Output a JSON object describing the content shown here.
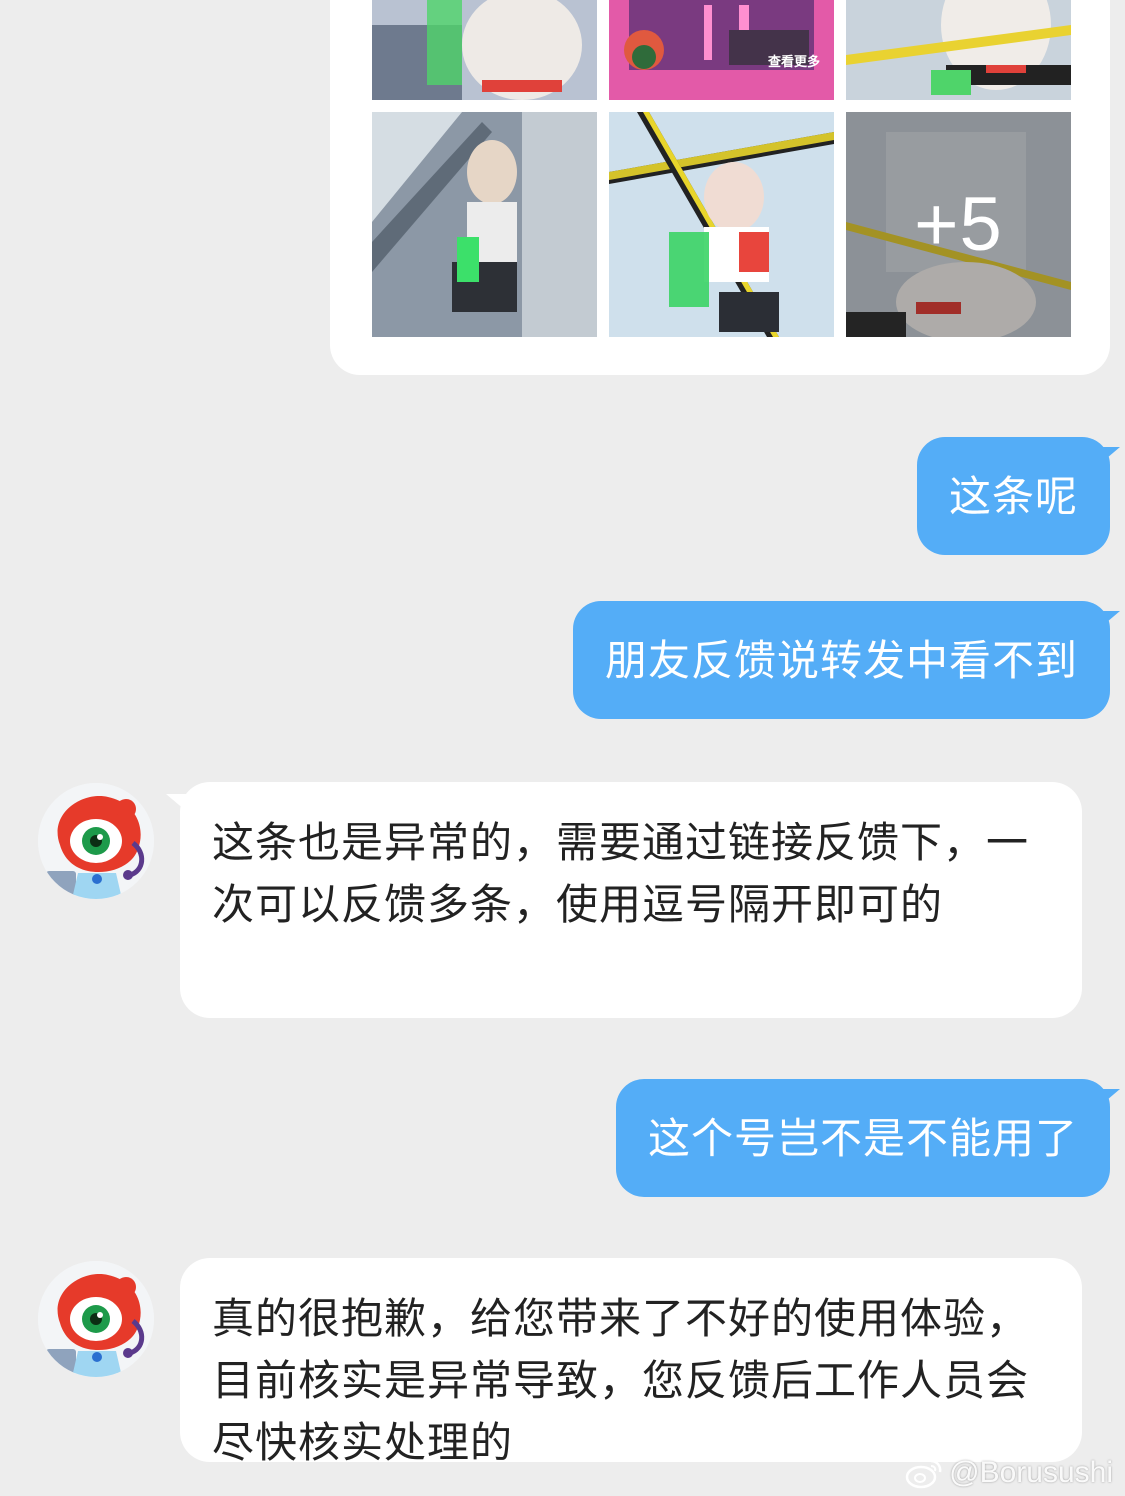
{
  "post": {
    "thumbnail_more_count": "+5",
    "thumbnail_caption": "查看更多"
  },
  "messages": [
    {
      "from": "me",
      "text": "这条呢"
    },
    {
      "from": "me",
      "text": "朋友反馈说转发中看不到"
    },
    {
      "from": "support",
      "text": "这条也是异常的，需要通过链接反馈下，一次可以反馈多条，使用逗号隔开即可的"
    },
    {
      "from": "me",
      "text": "这个号岂不是不能用了"
    },
    {
      "from": "support",
      "text": "真的很抱歉，给您带来了不好的使用体验，目前核实是异常导致，您反馈后工作人员会尽快核实处理的"
    }
  ],
  "watermark": {
    "text": "@Borusushi",
    "icon": "weibo-logo-icon"
  },
  "colors": {
    "my_bubble": "#54adf7",
    "their_bubble": "#ffffff",
    "background": "#ededed"
  }
}
